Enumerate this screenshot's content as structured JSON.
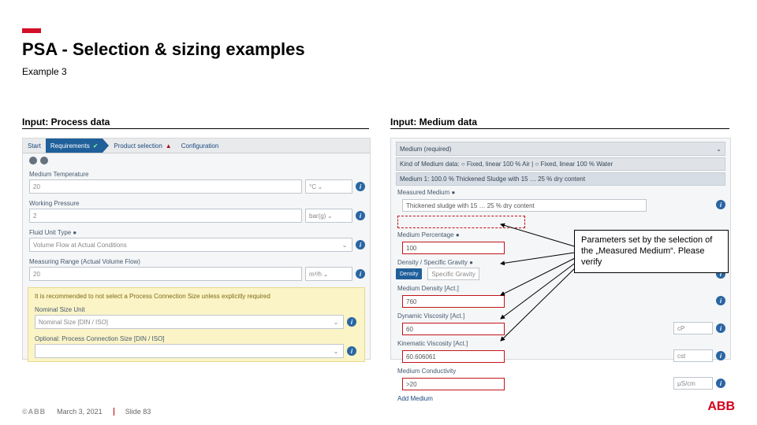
{
  "header": {
    "title": "PSA - Selection & sizing examples",
    "subtitle": "Example 3"
  },
  "sections": {
    "left": {
      "label": "Input: Process data"
    },
    "right": {
      "label": "Input: Medium data"
    }
  },
  "wizard": {
    "start": "Start",
    "requirements": "Requirements",
    "product_selection": "Product selection",
    "configuration": "Configuration"
  },
  "process": {
    "medium_temp_label": "Medium Temperature",
    "medium_temp_value": "20",
    "medium_temp_unit": "°C",
    "pressure_label": "Working Pressure",
    "pressure_value": "2",
    "pressure_unit": "bar(g)",
    "fluidunit_label": "Fluid Unit Type ●",
    "fluidunit_value": "Volume Flow at Actual Conditions",
    "measrange_label": "Measuring Range (Actual Volume Flow)",
    "measrange_value": "20",
    "measrange_unit": "m³/h",
    "recommend": "It is recommended to not select a Process Connection Size unless explicitly required",
    "nominal_label": "Nominal Size Unit",
    "nominal_value": "Nominal Size [DIN / ISO]",
    "optsize_label": "Optional: Process Connection Size [DIN / ISO]"
  },
  "medium": {
    "header": "Medium (required)",
    "kind_row": "Kind of Medium data:   ○ Fixed, linear   100 % Air   |   ○ Fixed, linear   100 % Water",
    "medium1": "Medium 1:  100.0 % Thickened Sludge with 15 … 25 % dry content",
    "measured_label": "Measured Medium ●",
    "measured_value": "Thickened sludge with 15 … 25 % dry content",
    "medium_pct_label": "Medium Percentage ●",
    "medium_pct_value": "100",
    "density_label": "Density / Specific Gravity ●",
    "density_btn": "Density",
    "density_btn2": "Specific Gravity",
    "density_value_label": "Medium Density [Act.]",
    "density_value": "760",
    "dynvisc_label": "Dynamic Viscosity [Act.]",
    "dynvisc_value": "60",
    "dynvisc_unit": "cP",
    "kinvisc_label": "Kinematic Viscosity [Act.]",
    "kinvisc_value": "60.606061",
    "kinvisc_unit": "cst",
    "conduct_label": "Medium Conductivity",
    "conduct_value": ">20",
    "conduct_unit": "µS/cm",
    "add": "Add Medium"
  },
  "callout": "Parameters set by the selection of the „Measured Medium“. Please verify",
  "icons": {
    "info": "i",
    "chev": "⌄",
    "tri": "▲"
  },
  "footer": {
    "copyright": "©ABB",
    "date": "March 3, 2021",
    "slide": "Slide 83",
    "brand": "ABB"
  }
}
